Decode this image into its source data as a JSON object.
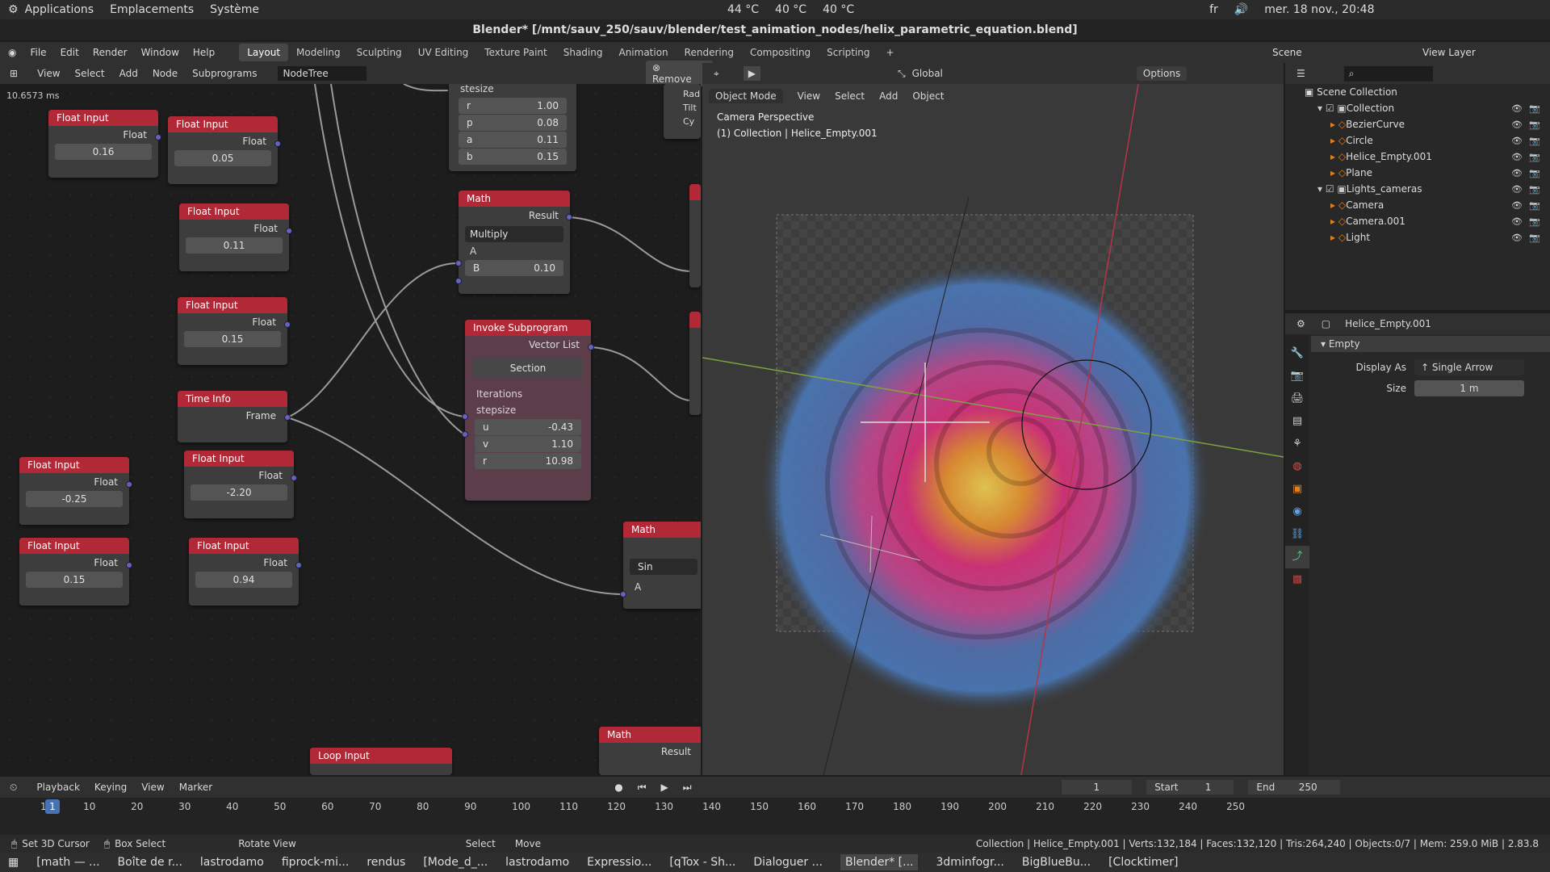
{
  "system_bar": {
    "apps": "Applications",
    "places": "Emplacements",
    "system": "Système",
    "temp1": "44 °C",
    "temp2": "40 °C",
    "temp3": "40 °C",
    "lang": "fr",
    "datetime": "mer. 18 nov., 20:48"
  },
  "window_title": "Blender* [/mnt/sauv_250/sauv/blender/test_animation_nodes/helix_parametric_equation.blend]",
  "menu": {
    "items": [
      "File",
      "Edit",
      "Render",
      "Window",
      "Help"
    ],
    "workspaces": [
      "Layout",
      "Modeling",
      "Sculpting",
      "UV Editing",
      "Texture Paint",
      "Shading",
      "Animation",
      "Rendering",
      "Compositing",
      "Scripting"
    ],
    "scene": "Scene",
    "view_layer": "View Layer"
  },
  "node_header": {
    "items": [
      "View",
      "Select",
      "Add",
      "Node",
      "Subprograms"
    ],
    "tree": "NodeTree",
    "remove": "Remove",
    "timing": "10.6573 ms"
  },
  "nodes": {
    "fi1": {
      "title": "Float Input",
      "out": "Float",
      "value": "0.16"
    },
    "fi2": {
      "title": "Float Input",
      "out": "Float",
      "value": "0.05"
    },
    "fi3": {
      "title": "Float Input",
      "out": "Float",
      "value": "0.11"
    },
    "fi4": {
      "title": "Float Input",
      "out": "Float",
      "value": "0.15"
    },
    "time": {
      "title": "Time Info",
      "out": "Frame"
    },
    "fi5": {
      "title": "Float Input",
      "out": "Float",
      "value": "-0.25"
    },
    "fi6": {
      "title": "Float Input",
      "out": "Float",
      "value": "-2.20"
    },
    "fi7": {
      "title": "Float Input",
      "out": "Float",
      "value": "0.15"
    },
    "fi8": {
      "title": "Float Input",
      "out": "Float",
      "value": "0.94"
    },
    "top": {
      "stesize": "stesize",
      "r_label": "r",
      "r": "1.00",
      "p_label": "p",
      "p": "0.08",
      "a_label": "a",
      "a": "0.11",
      "b_label": "b",
      "b": "0.15"
    },
    "math1": {
      "title": "Math",
      "out": "Result",
      "op": "Multiply",
      "a": "A",
      "b_label": "B",
      "b": "0.10"
    },
    "invoke": {
      "title": "Invoke Subprogram",
      "out": "Vector List",
      "section": "Section",
      "iter": "Iterations",
      "stepsize": "stepsize",
      "u_label": "u",
      "u": "-0.43",
      "v_label": "v",
      "v": "1.10",
      "r_label": "r",
      "r": "10.98"
    },
    "math2": {
      "title": "Math",
      "op": "Sin",
      "a": "A"
    },
    "math3": {
      "title": "Math",
      "out": "Result"
    },
    "loop": {
      "title": "Loop Input"
    },
    "right_partial": {
      "rad": "Rad",
      "tilt": "Tilt",
      "cy": "Cy"
    }
  },
  "viewport_header": {
    "mode": "Object Mode",
    "items": [
      "View",
      "Select",
      "Add",
      "Object"
    ],
    "transform": "Global",
    "options": "Options",
    "perspective": "Camera Perspective",
    "collection": "(1) Collection | Helice_Empty.001"
  },
  "outliner": {
    "root": "Scene Collection",
    "items": [
      {
        "label": "Collection",
        "level": 1
      },
      {
        "label": "BezierCurve",
        "level": 2
      },
      {
        "label": "Circle",
        "level": 2
      },
      {
        "label": "Helice_Empty.001",
        "level": 2
      },
      {
        "label": "Plane",
        "level": 2
      },
      {
        "label": "Lights_cameras",
        "level": 1
      },
      {
        "label": "Camera",
        "level": 2
      },
      {
        "label": "Camera.001",
        "level": 2
      },
      {
        "label": "Light",
        "level": 2
      }
    ]
  },
  "properties": {
    "object": "Helice_Empty.001",
    "panel": "Empty",
    "display_label": "Display As",
    "display_value": "Single Arrow",
    "size_label": "Size",
    "size_value": "1 m"
  },
  "timeline": {
    "items": [
      "Playback",
      "Keying",
      "View",
      "Marker"
    ],
    "current": "1",
    "start_label": "Start",
    "start": "1",
    "end_label": "End",
    "end": "250",
    "ticks": [
      "1",
      "10",
      "20",
      "30",
      "40",
      "50",
      "60",
      "70",
      "80",
      "90",
      "100",
      "110",
      "120",
      "130",
      "140",
      "150",
      "160",
      "170",
      "180",
      "190",
      "200",
      "210",
      "220",
      "230",
      "240",
      "250"
    ]
  },
  "statusbar": {
    "cursor": "Set 3D Cursor",
    "box": "Box Select",
    "rotate": "Rotate View",
    "select": "Select",
    "move": "Move",
    "stats": "Collection | Helice_Empty.001 | Verts:132,184 | Faces:132,120 | Tris:264,240 | Objects:0/7 | Mem: 259.0 MiB | 2.83.8"
  },
  "taskbar": [
    "[math — ...",
    "Boîte de r...",
    "lastrodamo",
    "fiprock-mi...",
    "rendus",
    "[Mode_d_...",
    "lastrodamo",
    "Expressio...",
    "[qTox - Sh...",
    "Dialoguer ...",
    "Blender* [...",
    "3dminfogr...",
    "BigBlueBu...",
    "[Clocktimer]"
  ]
}
